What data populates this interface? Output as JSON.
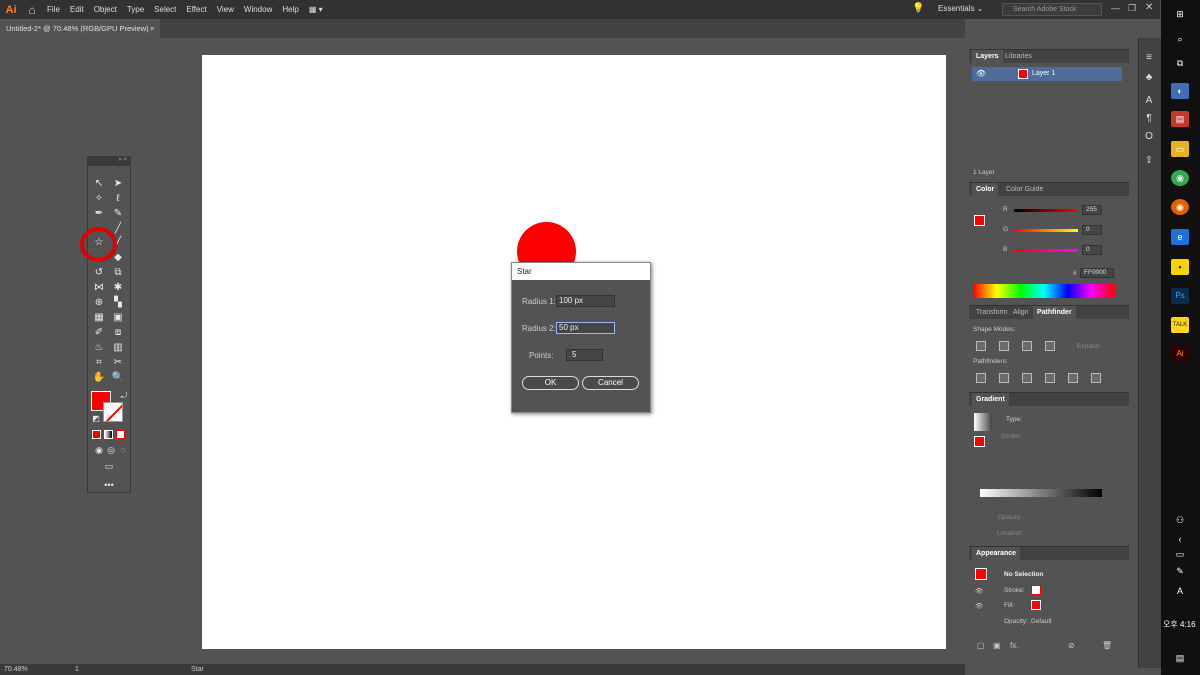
{
  "app": {
    "logo": "Ai",
    "menus": [
      "File",
      "Edit",
      "Object",
      "Type",
      "Select",
      "Effect",
      "View",
      "Window",
      "Help"
    ],
    "workspace": "Essentials",
    "search_placeholder": "Search Adobe Stock"
  },
  "document": {
    "tab_title": "Untitled-2* @ 70.48% (RGB/GPU Preview)",
    "zoom": "70.48%",
    "page": "1",
    "status_tool": "Star",
    "shape_color": "#ff0000"
  },
  "dialog": {
    "title": "Star",
    "radius1_label": "Radius 1:",
    "radius1_value": "100 px",
    "radius2_label": "Radius 2:",
    "radius2_value": "50 px",
    "points_label": "Points:",
    "points_value": "5",
    "ok_label": "OK",
    "cancel_label": "Cancel"
  },
  "layers": {
    "tabs": [
      "Layers",
      "Libraries"
    ],
    "layer_name": "Layer 1",
    "count": "1 Layer"
  },
  "color": {
    "tabs": [
      "Color",
      "Color Guide"
    ],
    "r_label": "R",
    "g_label": "G",
    "b_label": "B",
    "r": "255",
    "g": "0",
    "b": "0",
    "hex": "FF0000",
    "fill": "#ff0000"
  },
  "transform": {
    "tabs": [
      "Transform",
      "Align",
      "Pathfinder"
    ],
    "shape_modes": "Shape Modes:",
    "pathfinders": "Pathfinders:",
    "expand": "Expand"
  },
  "gradient": {
    "title": "Gradient",
    "type": "Type:",
    "stroke": "Stroke:",
    "opacity": "Opacity:",
    "location": "Location:"
  },
  "appearance": {
    "title": "Appearance",
    "selection": "No Selection",
    "stroke": "Stroke:",
    "fill": "Fill:",
    "opacity": "Opacity:",
    "opacity_value": "Default"
  },
  "taskbar": {
    "time": "오후 4:16"
  }
}
